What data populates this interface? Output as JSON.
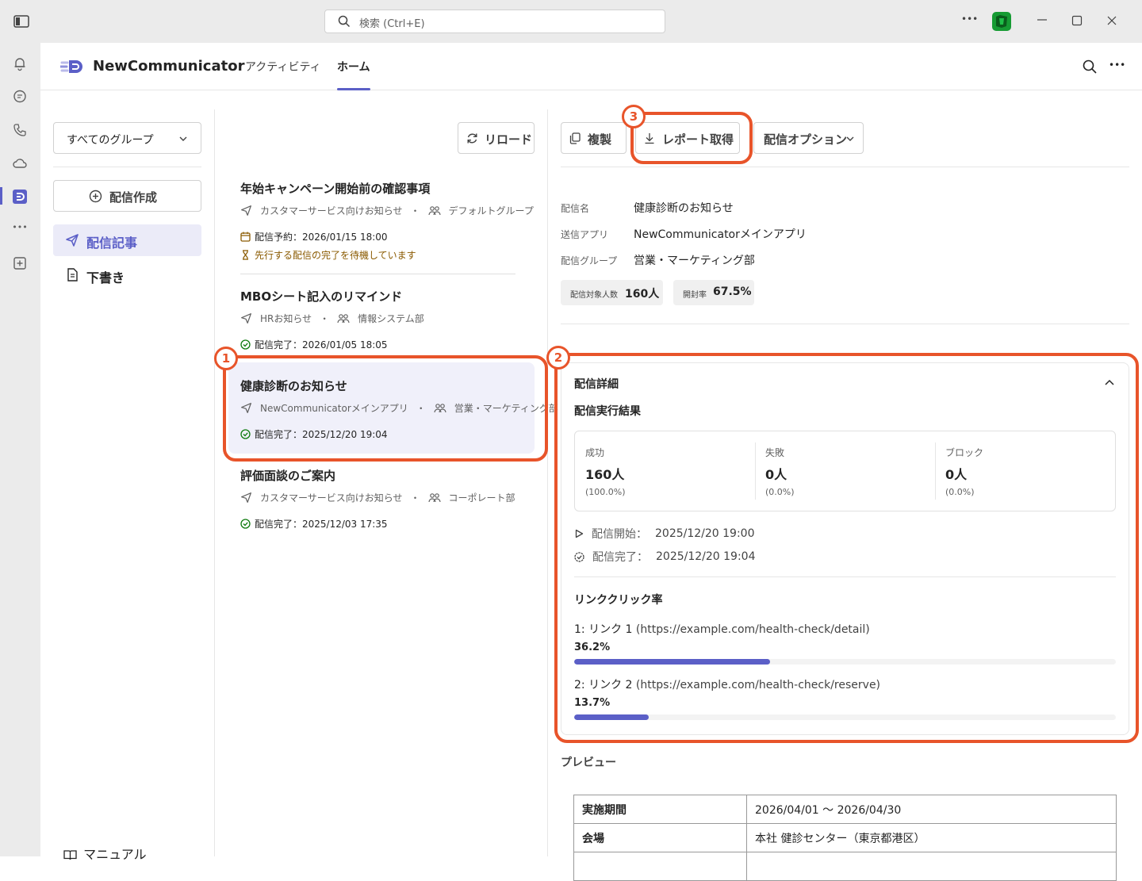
{
  "window": {
    "search_placeholder": "検索 (Ctrl+E)",
    "more_label": "•••"
  },
  "app": {
    "name": "NewCommunicator",
    "tabs": [
      {
        "label": "アクティビティ",
        "active": false
      },
      {
        "label": "ホーム",
        "active": true
      }
    ]
  },
  "sidebar": {
    "group_select": "すべてのグループ",
    "create_button": "配信作成",
    "nav": [
      {
        "label": "配信記事",
        "active": true
      },
      {
        "label": "下書き",
        "active": false
      }
    ],
    "manual": "マニュアル"
  },
  "list": {
    "reload_button": "リロード",
    "items": [
      {
        "title": "年始キャンペーン開始前の確認事項",
        "app": "カスタマーサービス向けお知らせ",
        "group": "デフォルトグループ",
        "status": "配信予約：2026/01/15 18:00",
        "status_type": "scheduled",
        "note": "先行する配信の完了を待機しています"
      },
      {
        "title": "MBOシート記入のリマインド",
        "app": "HRお知らせ",
        "group": "情報システム部",
        "status": "配信完了：2026/01/05 18:05",
        "status_type": "done"
      },
      {
        "title": "健康診断のお知らせ",
        "app": "NewCommunicatorメインアプリ",
        "group": "営業・マーケティング部",
        "status": "配信完了：2025/12/20 19:04",
        "status_type": "done",
        "selected": true
      },
      {
        "title": "評価面談のご案内",
        "app": "カスタマーサービス向けお知らせ",
        "group": "コーポレート部",
        "status": "配信完了：2025/12/03 17:35",
        "status_type": "done"
      }
    ],
    "separator": "・"
  },
  "detail": {
    "toolbar": {
      "duplicate": "複製",
      "report": "レポート取得",
      "options": "配信オプション"
    },
    "fields": [
      {
        "key": "配信名",
        "value": "健康診断のお知らせ"
      },
      {
        "key": "送信アプリ",
        "value": "NewCommunicatorメインアプリ"
      },
      {
        "key": "配信グループ",
        "value": "営業・マーケティング部"
      }
    ],
    "pills": [
      {
        "key": "配信対象人数",
        "value": "160人"
      },
      {
        "key": "開封率",
        "value": "67.5%"
      }
    ],
    "section_title": "配信詳細",
    "result_title": "配信実行結果",
    "stats": [
      {
        "label": "成功",
        "value": "160人",
        "pct": "(100.0%)"
      },
      {
        "label": "失敗",
        "value": "0人",
        "pct": "(0.0%)"
      },
      {
        "label": "ブロック",
        "value": "0人",
        "pct": "(0.0%)"
      }
    ],
    "timeline": [
      {
        "label": "配信開始：",
        "value": "2025/12/20 19:00"
      },
      {
        "label": "配信完了：",
        "value": "2025/12/20 19:04"
      }
    ],
    "link_title": "リンククリック率",
    "links": [
      {
        "label": "1: リンク 1",
        "url": "(https://example.com/health-check/detail)",
        "pct_label": "36.2%",
        "rate": 0.362
      },
      {
        "label": "2: リンク 2",
        "url": "(https://example.com/health-check/reserve)",
        "pct_label": "13.7%",
        "rate": 0.137
      }
    ],
    "preview_title": "プレビュー",
    "preview_rows": [
      {
        "k": "実施期間",
        "v": "2026/04/01 〜 2026/04/30"
      },
      {
        "k": "会場",
        "v": "本社 健診センター（東京都港区）"
      }
    ]
  },
  "annotations": [
    {
      "label": "1"
    },
    {
      "label": "2"
    },
    {
      "label": "3"
    }
  ],
  "colors": {
    "accent": "#5b5fc7",
    "highlight": "#e8542a",
    "success": "#107c10",
    "warning": "#8a5a00"
  }
}
